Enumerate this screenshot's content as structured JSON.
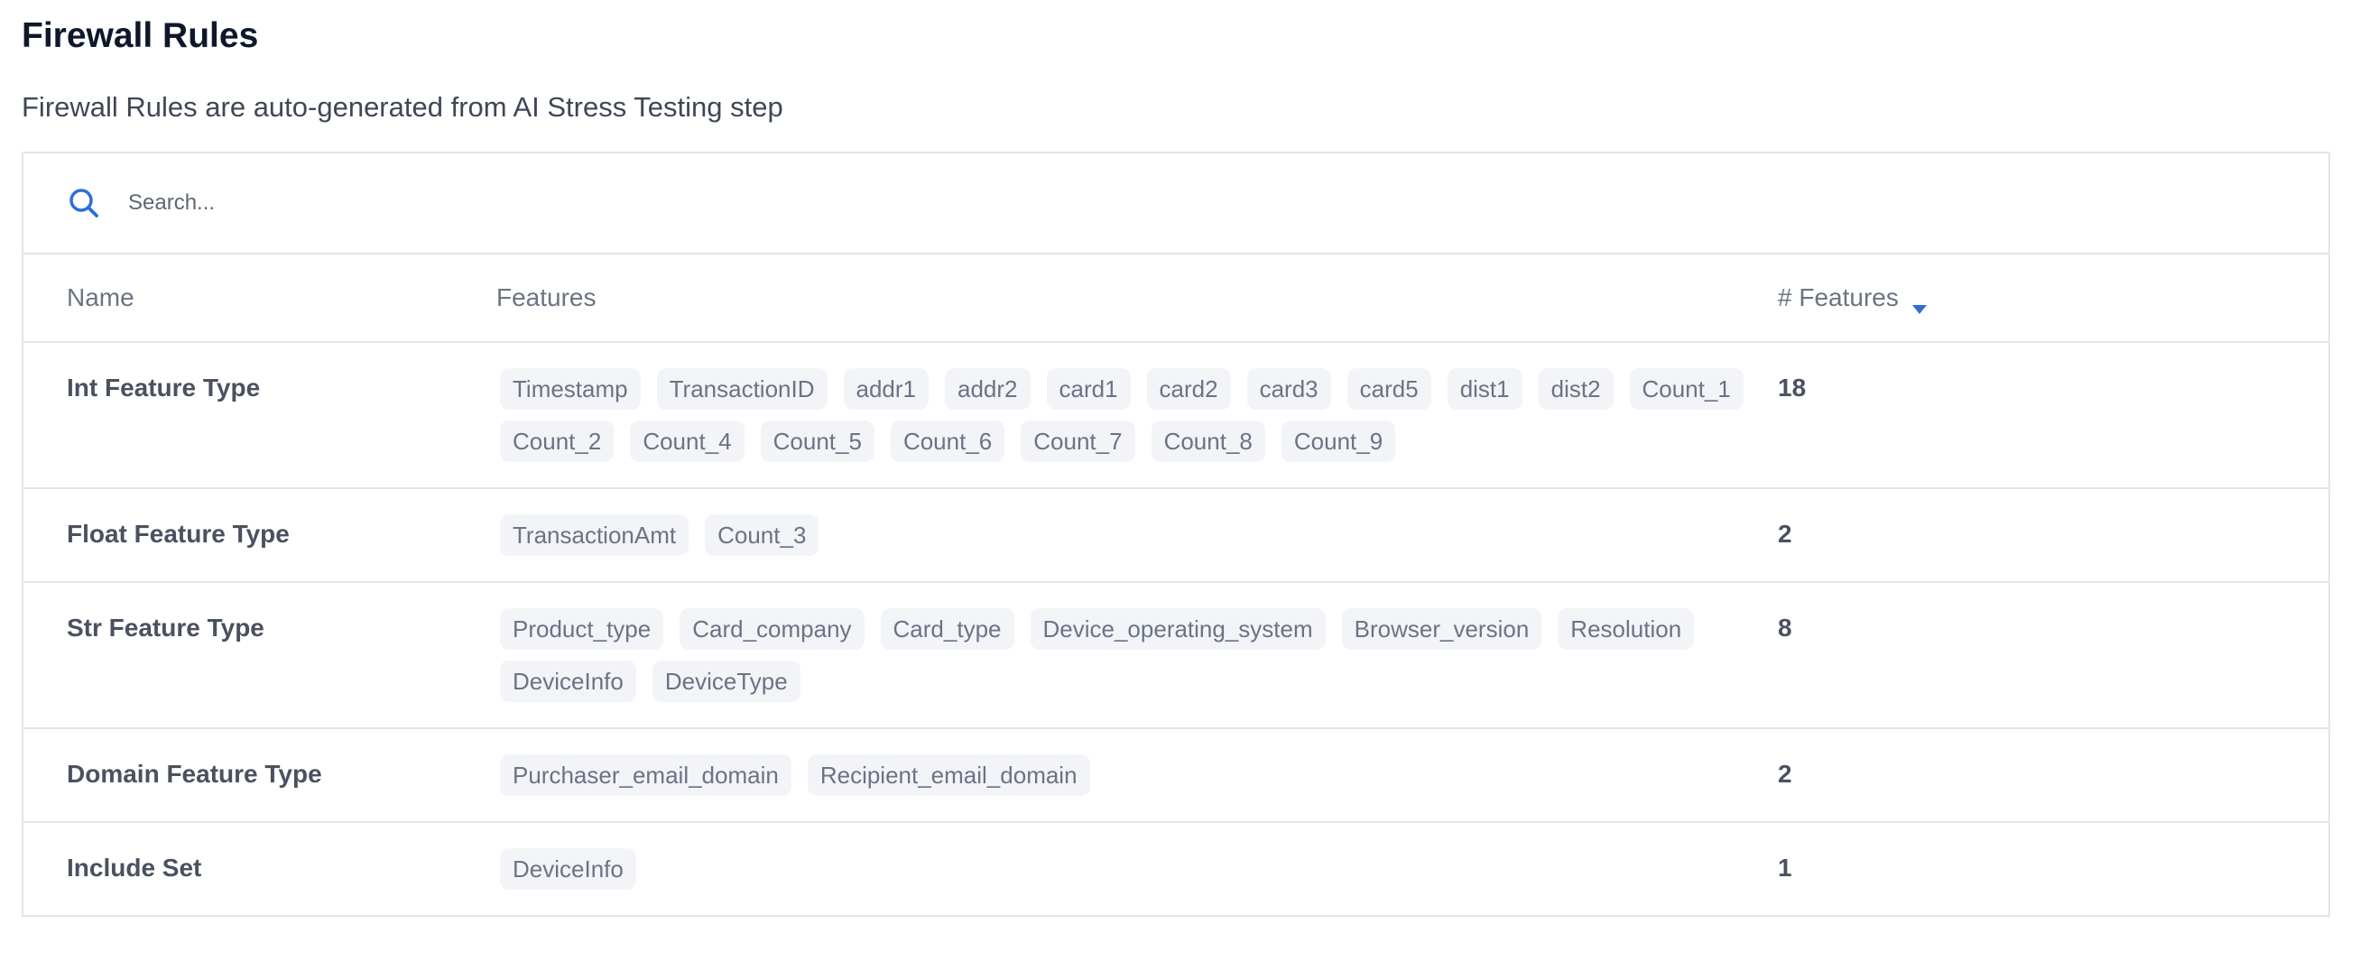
{
  "page": {
    "title": "Firewall Rules",
    "subtitle": "Firewall Rules are auto-generated from AI Stress Testing step"
  },
  "search": {
    "placeholder": "Search...",
    "value": ""
  },
  "table": {
    "headers": {
      "name": "Name",
      "features": "Features",
      "count": "# Features"
    },
    "sort": {
      "column": "# Features",
      "direction": "descending"
    },
    "rows": [
      {
        "name": "Int Feature Type",
        "features": [
          "Timestamp",
          "TransactionID",
          "addr1",
          "addr2",
          "card1",
          "card2",
          "card3",
          "card5",
          "dist1",
          "dist2",
          "Count_1",
          "Count_2",
          "Count_4",
          "Count_5",
          "Count_6",
          "Count_7",
          "Count_8",
          "Count_9"
        ],
        "count": "18"
      },
      {
        "name": "Float Feature Type",
        "features": [
          "TransactionAmt",
          "Count_3"
        ],
        "count": "2"
      },
      {
        "name": "Str Feature Type",
        "features": [
          "Product_type",
          "Card_company",
          "Card_type",
          "Device_operating_system",
          "Browser_version",
          "Resolution",
          "DeviceInfo",
          "DeviceType"
        ],
        "count": "8"
      },
      {
        "name": "Domain Feature Type",
        "features": [
          "Purchaser_email_domain",
          "Recipient_email_domain"
        ],
        "count": "2"
      },
      {
        "name": "Include Set",
        "features": [
          "DeviceInfo"
        ],
        "count": "1"
      }
    ]
  },
  "colors": {
    "accent": "#2f6fd6",
    "chip_bg": "#f2f4f7",
    "border": "#e2e5ea"
  },
  "icons": {
    "search": "search-icon",
    "sort": "caret-down-icon"
  }
}
